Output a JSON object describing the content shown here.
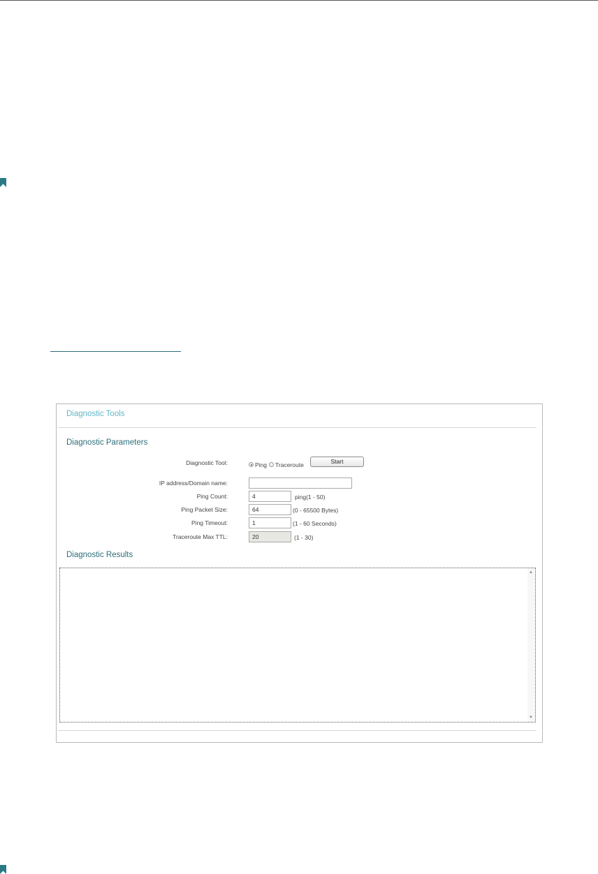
{
  "panel": {
    "title": "Diagnostic Tools",
    "parameters_heading": "Diagnostic Parameters",
    "results_heading": "Diagnostic Results"
  },
  "tool": {
    "label": "Diagnostic Tool:",
    "options": [
      {
        "label": "Ping",
        "checked": true
      },
      {
        "label": "Traceroute",
        "checked": false
      }
    ],
    "start_label": "Start"
  },
  "fields": {
    "ip": {
      "label": "IP address/Domain name:",
      "value": "",
      "hint": ""
    },
    "ping_count": {
      "label": "Ping Count:",
      "value": "4",
      "hint": "ping(1 - 50)"
    },
    "packet_size": {
      "label": "Ping Packet Size:",
      "value": "64",
      "hint": "(0 - 65500 Bytes)"
    },
    "timeout": {
      "label": "Ping Timeout:",
      "value": "1",
      "hint": "(1 - 60 Seconds)"
    },
    "max_ttl": {
      "label": "Traceroute Max TTL:",
      "value": "20",
      "hint": "(1 - 30)"
    }
  },
  "results": {
    "text": ""
  },
  "colors": {
    "accent": "#5fb7c9",
    "heading": "#2d6e78",
    "bookmark": "#2a7a86"
  },
  "icons": {
    "bookmark": "bookmark-icon",
    "scroll_up": "scroll-up-icon",
    "scroll_down": "scroll-down-icon"
  }
}
